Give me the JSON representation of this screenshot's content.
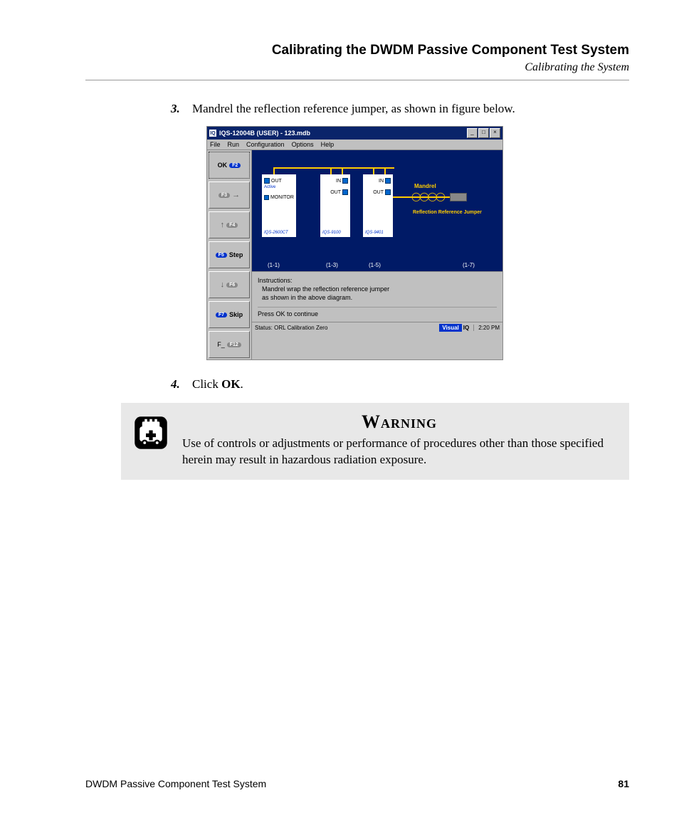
{
  "header": {
    "title": "Calibrating the DWDM Passive Component Test System",
    "subtitle": "Calibrating the System"
  },
  "steps": {
    "s3": {
      "num": "3.",
      "text": "Mandrel the reflection reference jumper, as shown in figure below."
    },
    "s4": {
      "num": "4.",
      "pre": "Click ",
      "bold": "OK",
      "post": "."
    }
  },
  "screenshot": {
    "titlebar": {
      "icon": "IQ",
      "title": "IQS-12004B (USER) - 123.mdb"
    },
    "menus": [
      "File",
      "Run",
      "Configuration",
      "Options",
      "Help"
    ],
    "fkeys": {
      "ok": {
        "label": "OK",
        "badge": "F2"
      },
      "f3": {
        "badge": "F3"
      },
      "f4": {
        "badge": "F4"
      },
      "step": {
        "label": "Step",
        "badge": "F5"
      },
      "f6": {
        "badge": "F6"
      },
      "skip": {
        "label": "Skip",
        "badge": "F7"
      },
      "f12": {
        "label": "F_",
        "badge": "F12"
      }
    },
    "diagram": {
      "mod1": {
        "p1": "OUT",
        "p2": "Active",
        "p3": "MONITOR",
        "name": "IQS-2600CT"
      },
      "mod2": {
        "p1": "IN",
        "p2": "OUT",
        "name": "IQS-9100"
      },
      "mod3": {
        "p1": "IN",
        "p2": "OUT",
        "name": "IQS-9401"
      },
      "mandrel": "Mandrel",
      "refjumper": "Reflection Reference Jumper",
      "slots": {
        "s1": "(1-1)",
        "s2": "(1-3)",
        "s3": "(1-5)",
        "s4": "(1-7)"
      }
    },
    "instructions": {
      "heading": "Instructions:",
      "line1": "Mandrel wrap the reflection reference jumper",
      "line2": "as shown in the above diagram.",
      "ok": "Press OK to continue"
    },
    "statusbar": {
      "status": "Status: ORL Calibration Zero",
      "visual": "Visual",
      "iq": "IQ",
      "time": "2:20 PM"
    }
  },
  "warning": {
    "title": "Warning",
    "text": "Use of controls or adjustments or performance of procedures other than those specified herein may result in hazardous radiation exposure."
  },
  "footer": {
    "left": "DWDM Passive Component Test System",
    "right": "81"
  }
}
